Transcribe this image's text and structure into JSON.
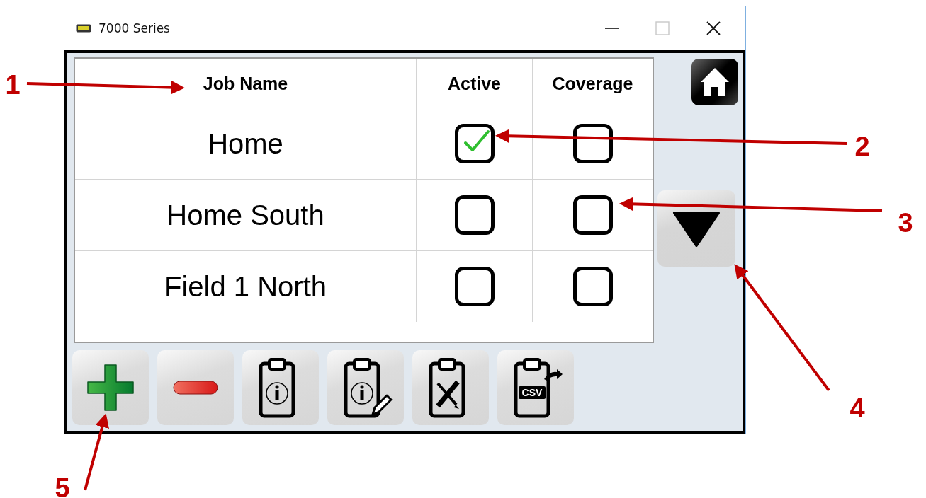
{
  "window": {
    "title": "7000 Series",
    "controls": [
      {
        "kind": "minimize",
        "disabled": false
      },
      {
        "kind": "maximize",
        "disabled": true
      },
      {
        "kind": "close",
        "disabled": false
      }
    ]
  },
  "table": {
    "columns": [
      "Job Name",
      "Active",
      "Coverage"
    ],
    "rows": [
      {
        "name": "Home",
        "active": true,
        "coverage": false
      },
      {
        "name": "Home South",
        "active": false,
        "coverage": false
      },
      {
        "name": "Field 1 North",
        "active": false,
        "coverage": false
      }
    ]
  },
  "toolbar": [
    {
      "kind": "add"
    },
    {
      "kind": "remove"
    },
    {
      "kind": "info"
    },
    {
      "kind": "edit"
    },
    {
      "kind": "tools"
    },
    {
      "kind": "export",
      "label": "CSV"
    }
  ],
  "side_buttons": [
    {
      "kind": "home"
    },
    {
      "kind": "scroll_down"
    }
  ],
  "annotations": [
    {
      "label": "1"
    },
    {
      "label": "2"
    },
    {
      "label": "3"
    },
    {
      "label": "4"
    },
    {
      "label": "5"
    }
  ]
}
